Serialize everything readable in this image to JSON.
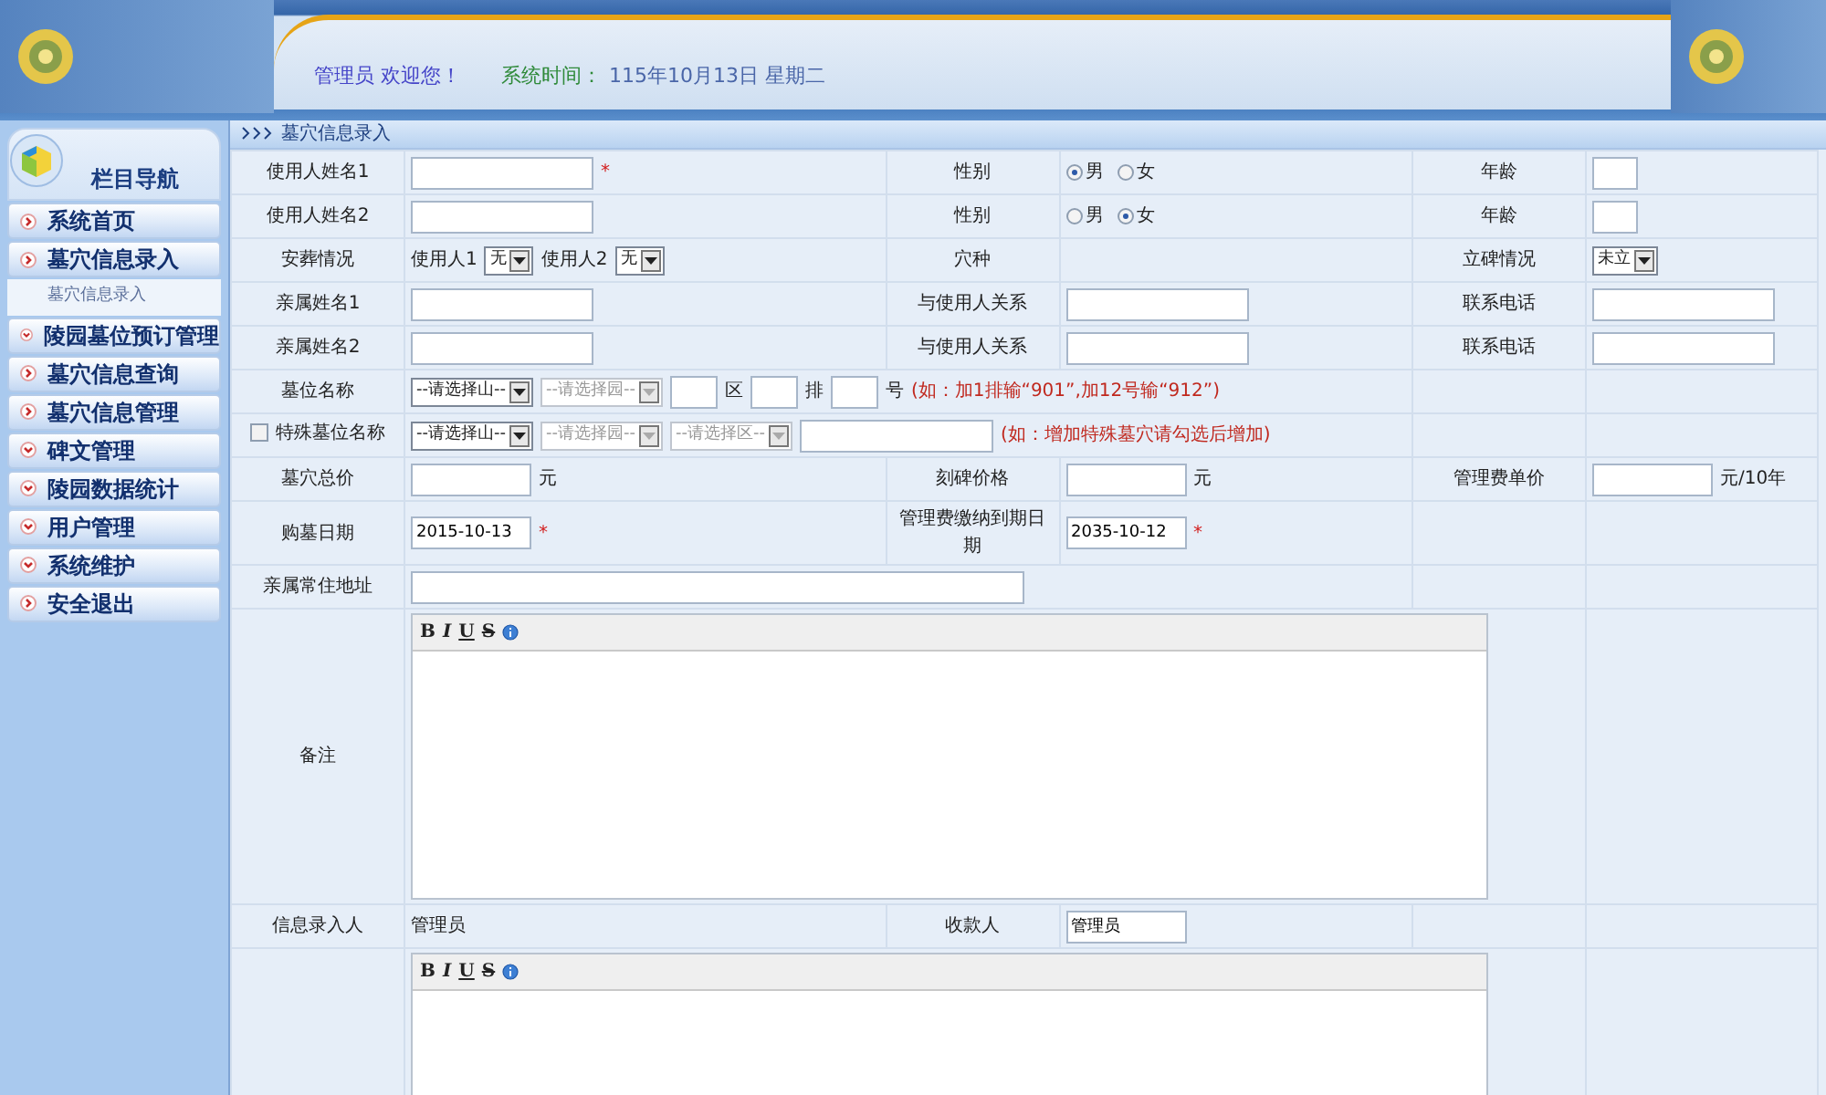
{
  "header": {
    "greeting": "管理员 欢迎您！",
    "time_label": "系统时间：",
    "time": "115年10月13日 星期二"
  },
  "sidebar": {
    "title": "栏目导航",
    "items": [
      {
        "label": "系统首页",
        "kind": "link"
      },
      {
        "label": "墓穴信息录入",
        "kind": "link",
        "children": [
          {
            "label": "墓穴信息录入"
          }
        ]
      },
      {
        "label": "陵园墓位预订管理",
        "kind": "menu"
      },
      {
        "label": "墓穴信息查询",
        "kind": "link"
      },
      {
        "label": "墓穴信息管理",
        "kind": "link"
      },
      {
        "label": "碑文管理",
        "kind": "menu"
      },
      {
        "label": "陵园数据统计",
        "kind": "menu"
      },
      {
        "label": "用户管理",
        "kind": "menu"
      },
      {
        "label": "系统维护",
        "kind": "menu"
      },
      {
        "label": "安全退出",
        "kind": "link"
      }
    ]
  },
  "form": {
    "title": "墓穴信息录入",
    "rows": [
      {
        "cells": [
          {
            "kind": "label",
            "text": "使用人姓名1"
          },
          {
            "kind": "fields",
            "items": [
              {
                "kind": "input"
              },
              {
                "kind": "required",
                "text": "*"
              }
            ]
          },
          {
            "kind": "label",
            "text": "性别"
          },
          {
            "kind": "fields",
            "items": [
              {
                "kind": "radio",
                "label": "男",
                "selected": true
              },
              {
                "kind": "radio",
                "label": "女",
                "selected": false
              }
            ]
          },
          {
            "kind": "label",
            "text": "年龄"
          },
          {
            "kind": "fields",
            "items": [
              {
                "kind": "short_input"
              }
            ]
          }
        ]
      },
      {
        "cells": [
          {
            "kind": "label",
            "text": "使用人姓名2"
          },
          {
            "kind": "fields",
            "items": [
              {
                "kind": "input"
              }
            ]
          },
          {
            "kind": "label",
            "text": "性别"
          },
          {
            "kind": "fields",
            "items": [
              {
                "kind": "radio",
                "label": "男",
                "selected": false
              },
              {
                "kind": "radio",
                "label": "女",
                "selected": true
              }
            ]
          },
          {
            "kind": "label",
            "text": "年龄"
          },
          {
            "kind": "fields",
            "items": [
              {
                "kind": "short_input"
              }
            ]
          }
        ]
      },
      {
        "cells": [
          {
            "kind": "label",
            "text": "安葬情况"
          },
          {
            "kind": "fields",
            "items": [
              {
                "kind": "text",
                "text": "使用人1"
              },
              {
                "kind": "select",
                "value": "无",
                "disabled": false
              },
              {
                "kind": "text",
                "text": "使用人2"
              },
              {
                "kind": "select",
                "value": "无",
                "disabled": false
              }
            ]
          },
          {
            "kind": "label",
            "text": "穴种"
          },
          {
            "kind": "blank"
          },
          {
            "kind": "label",
            "text": "立碑情况"
          },
          {
            "kind": "fields",
            "items": [
              {
                "kind": "select",
                "value": "未立",
                "disabled": false
              }
            ]
          }
        ]
      },
      {
        "cells": [
          {
            "kind": "label",
            "text": "亲属姓名1"
          },
          {
            "kind": "fields",
            "items": [
              {
                "kind": "input"
              }
            ]
          },
          {
            "kind": "label",
            "text": "与使用人关系"
          },
          {
            "kind": "fields",
            "items": [
              {
                "kind": "input"
              }
            ]
          },
          {
            "kind": "label",
            "text": "联系电话"
          },
          {
            "kind": "fields",
            "items": [
              {
                "kind": "input"
              }
            ]
          }
        ]
      },
      {
        "cells": [
          {
            "kind": "label",
            "text": "亲属姓名2"
          },
          {
            "kind": "fields",
            "items": [
              {
                "kind": "input"
              }
            ]
          },
          {
            "kind": "label",
            "text": "与使用人关系"
          },
          {
            "kind": "fields",
            "items": [
              {
                "kind": "input"
              }
            ]
          },
          {
            "kind": "label",
            "text": "联系电话"
          },
          {
            "kind": "fields",
            "items": [
              {
                "kind": "input"
              }
            ]
          }
        ]
      },
      {
        "cells": [
          {
            "kind": "label",
            "text": "墓位名称"
          },
          {
            "kind": "fields",
            "colspan": 3,
            "items": [
              {
                "kind": "select",
                "value": "--请选择山--",
                "disabled": false
              },
              {
                "kind": "select",
                "value": "--请选择园--",
                "disabled": true
              },
              {
                "kind": "tiny_input"
              },
              {
                "kind": "text",
                "text": "区"
              },
              {
                "kind": "tiny_input"
              },
              {
                "kind": "text",
                "text": "排"
              },
              {
                "kind": "tiny_input"
              },
              {
                "kind": "text",
                "text": "号"
              },
              {
                "kind": "hint",
                "text": "(如：加1排输“901”,加12号输“912”)"
              }
            ]
          },
          {
            "kind": "blank"
          },
          {
            "kind": "blank"
          }
        ]
      },
      {
        "cells": [
          {
            "kind": "check_label",
            "text": "特殊墓位名称",
            "checked": false
          },
          {
            "kind": "fields",
            "colspan": 3,
            "items": [
              {
                "kind": "select",
                "value": "--请选择山--",
                "disabled": false
              },
              {
                "kind": "select",
                "value": "--请选择园--",
                "disabled": true
              },
              {
                "kind": "select",
                "value": "--请选择区--",
                "disabled": true
              },
              {
                "kind": "wide_input"
              },
              {
                "kind": "hint",
                "text": "(如：增加特殊墓穴请勾选后增加)"
              }
            ]
          },
          {
            "kind": "blank"
          },
          {
            "kind": "blank"
          }
        ]
      },
      {
        "cells": [
          {
            "kind": "label",
            "text": "墓穴总价"
          },
          {
            "kind": "fields",
            "items": [
              {
                "kind": "mid_input"
              },
              {
                "kind": "text",
                "text": "元"
              }
            ]
          },
          {
            "kind": "label",
            "text": "刻碑价格"
          },
          {
            "kind": "fields",
            "items": [
              {
                "kind": "mid_input"
              },
              {
                "kind": "text",
                "text": "元"
              }
            ]
          },
          {
            "kind": "label",
            "text": "管理费单价"
          },
          {
            "kind": "fields",
            "items": [
              {
                "kind": "mid_input"
              },
              {
                "kind": "text",
                "text": "元/10年"
              }
            ]
          }
        ]
      },
      {
        "cells": [
          {
            "kind": "label",
            "text": "购墓日期"
          },
          {
            "kind": "fields",
            "items": [
              {
                "kind": "mid_input",
                "value": "2015-10-13"
              },
              {
                "kind": "required",
                "text": "*"
              }
            ]
          },
          {
            "kind": "label",
            "text": "管理费缴纳到期日期"
          },
          {
            "kind": "fields",
            "items": [
              {
                "kind": "mid_input",
                "value": "2035-10-12"
              },
              {
                "kind": "required",
                "text": "*"
              }
            ]
          },
          {
            "kind": "blank"
          },
          {
            "kind": "blank"
          }
        ]
      },
      {
        "cells": [
          {
            "kind": "label",
            "text": "亲属常住地址"
          },
          {
            "kind": "fields",
            "colspan": 3,
            "items": [
              {
                "kind": "long_input"
              }
            ]
          },
          {
            "kind": "blank"
          },
          {
            "kind": "blank"
          }
        ]
      },
      {
        "cells": [
          {
            "kind": "label",
            "text": "备注"
          },
          {
            "kind": "editor",
            "colspan": 4,
            "toolbar": [
              "B",
              "I",
              "U",
              "S"
            ]
          },
          {
            "kind": "blank"
          }
        ]
      },
      {
        "cells": [
          {
            "kind": "label",
            "text": "信息录入人"
          },
          {
            "kind": "fields",
            "items": [
              {
                "kind": "text",
                "text": "管理员"
              }
            ]
          },
          {
            "kind": "label",
            "text": "收款人"
          },
          {
            "kind": "fields",
            "items": [
              {
                "kind": "mid_input",
                "value": "管理员"
              }
            ]
          },
          {
            "kind": "blank"
          },
          {
            "kind": "blank"
          }
        ]
      },
      {
        "cells": [
          {
            "kind": "blank"
          },
          {
            "kind": "editor",
            "colspan": 4,
            "toolbar": [
              "B",
              "I",
              "U",
              "S"
            ]
          },
          {
            "kind": "blank"
          }
        ]
      }
    ]
  }
}
